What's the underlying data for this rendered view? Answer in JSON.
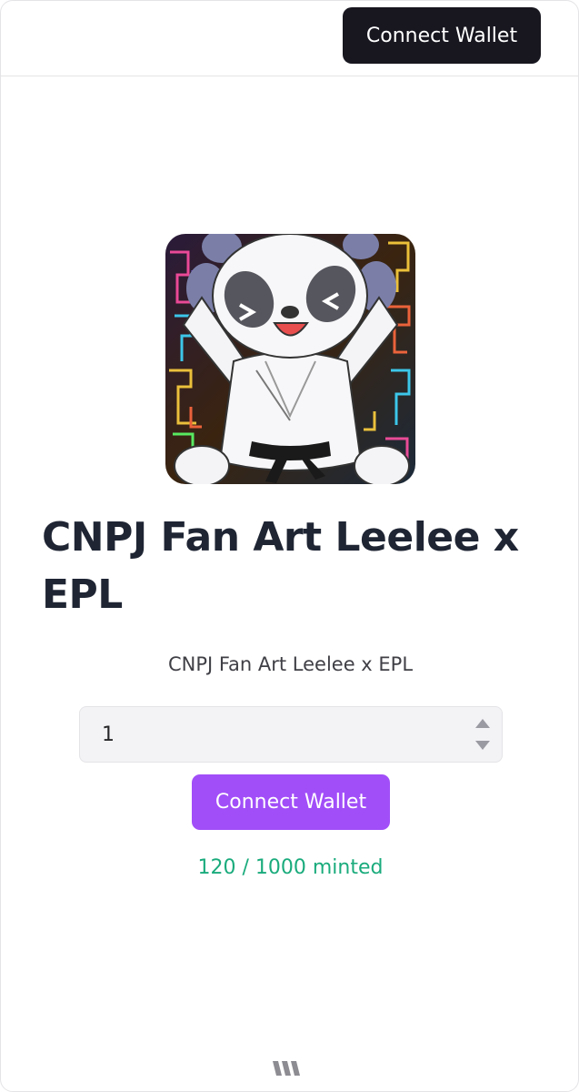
{
  "header": {
    "connect_wallet_label": "Connect Wallet"
  },
  "nft": {
    "image_icon": "panda-karate-artwork"
  },
  "collection": {
    "title": "CNPJ Fan Art Leelee x EPL",
    "description": "CNPJ Fan Art Leelee x EPL"
  },
  "mint": {
    "quantity_value": "1",
    "button_label": "Connect Wallet",
    "minted_status": "120 / 1000 minted",
    "minted_count": 120,
    "max_supply": 1000
  },
  "footer": {
    "logo_icon": "brand-logo-icon"
  },
  "colors": {
    "header_button": "#18161f",
    "mint_button": "#a14ef8",
    "minted_text": "#1aab7c",
    "title_text": "#1f2533"
  }
}
